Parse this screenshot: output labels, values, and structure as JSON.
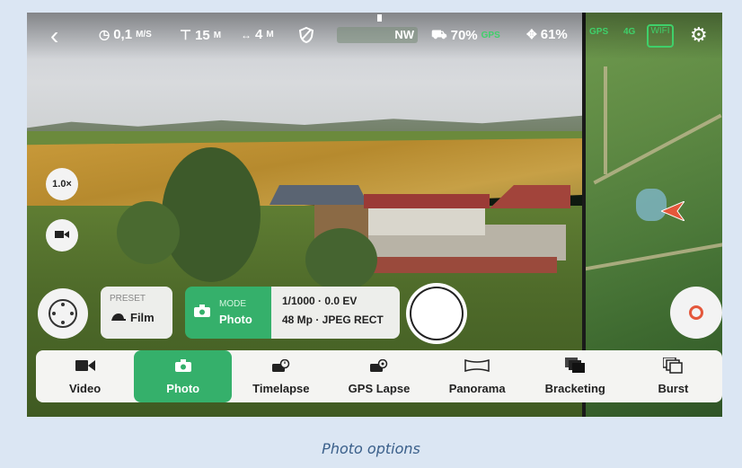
{
  "topbar": {
    "back": "‹",
    "speed_value": "0,1",
    "speed_unit": "M/S",
    "altitude_value": "15",
    "altitude_unit": "M",
    "distance_value": "4",
    "distance_unit": "M",
    "heading": "NW",
    "battery_drone": "70%",
    "gps_drone": "GPS",
    "battery_controller": "61%",
    "gps_controller": "GPS",
    "network_4g": "4G",
    "wifi": "WIFI"
  },
  "left_controls": {
    "zoom": "1.0×"
  },
  "preset": {
    "label": "PRESET",
    "value": "Film"
  },
  "mode": {
    "label": "MODE",
    "value": "Photo"
  },
  "settings": {
    "line1": "1/1000 · 0.0 EV",
    "line2": "48 Mp · JPEG RECT"
  },
  "modes": [
    {
      "label": "Video",
      "icon": "video-camera-icon",
      "active": false
    },
    {
      "label": "Photo",
      "icon": "photo-camera-icon",
      "active": true
    },
    {
      "label": "Timelapse",
      "icon": "timelapse-icon",
      "active": false
    },
    {
      "label": "GPS Lapse",
      "icon": "gps-lapse-icon",
      "active": false
    },
    {
      "label": "Panorama",
      "icon": "panorama-icon",
      "active": false
    },
    {
      "label": "Bracketing",
      "icon": "bracketing-icon",
      "active": false
    },
    {
      "label": "Burst",
      "icon": "burst-icon",
      "active": false
    }
  ],
  "caption": "Photo options",
  "colors": {
    "accent": "#35b06b",
    "caption": "#3a5f8a",
    "drone_marker": "#e4573b"
  }
}
